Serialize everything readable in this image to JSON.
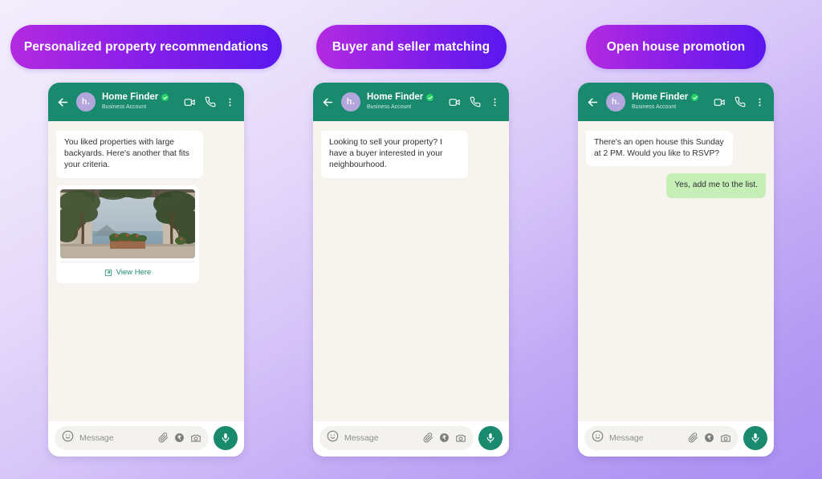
{
  "page": {
    "background_start": "#f2ecfb",
    "background_end": "#a98ef2"
  },
  "theme": {
    "pill_gradient_start": "#b32ae0",
    "pill_gradient_end": "#5a18ef",
    "whatsapp_green": "#1a8a6e",
    "verified_green": "#25d366",
    "outgoing_bubble": "#c5efb6",
    "chat_background": "#f7f4ef",
    "avatar_color": "#b3a6dd"
  },
  "panels": [
    {
      "badge_label": "Personalized property recommendations",
      "header": {
        "back_icon": "back-arrow-icon",
        "avatar_initials": "h.",
        "name": "Home Finder",
        "verified_icon": "verified-check-icon",
        "subtitle": "Business Account",
        "video_icon": "video-call-icon",
        "call_icon": "phone-call-icon",
        "menu_icon": "more-options-icon"
      },
      "messages": [
        {
          "type": "incoming",
          "text": "You liked properties with large backyards. Here's another that fits your criteria."
        },
        {
          "type": "media-card",
          "image_alt": "property-photo-terrace-sea-view",
          "link_icon": "external-link-icon",
          "link_label": "View Here"
        }
      ],
      "input": {
        "emoji_icon": "emoji-icon",
        "placeholder": "Message",
        "attach_icon": "paperclip-icon",
        "payment_icon": "rupee-payment-icon",
        "camera_icon": "camera-icon",
        "mic_icon": "microphone-icon"
      }
    },
    {
      "badge_label": "Buyer and seller matching",
      "header": {
        "back_icon": "back-arrow-icon",
        "avatar_initials": "h.",
        "name": "Home Finder",
        "verified_icon": "verified-check-icon",
        "subtitle": "Business Account",
        "video_icon": "video-call-icon",
        "call_icon": "phone-call-icon",
        "menu_icon": "more-options-icon"
      },
      "messages": [
        {
          "type": "incoming",
          "text": "Looking to sell your property? I have a buyer interested in your neighbourhood."
        }
      ],
      "input": {
        "emoji_icon": "emoji-icon",
        "placeholder": "Message",
        "attach_icon": "paperclip-icon",
        "payment_icon": "rupee-payment-icon",
        "camera_icon": "camera-icon",
        "mic_icon": "microphone-icon"
      }
    },
    {
      "badge_label": "Open house promotion",
      "header": {
        "back_icon": "back-arrow-icon",
        "avatar_initials": "h.",
        "name": "Home Finder",
        "verified_icon": "verified-check-icon",
        "subtitle": "Business Account",
        "video_icon": "video-call-icon",
        "call_icon": "phone-call-icon",
        "menu_icon": "more-options-icon"
      },
      "messages": [
        {
          "type": "incoming",
          "text": "There's an open house this Sunday at 2 PM. Would you like to RSVP?"
        },
        {
          "type": "outgoing",
          "text": "Yes, add me to the list."
        }
      ],
      "input": {
        "emoji_icon": "emoji-icon",
        "placeholder": "Message",
        "attach_icon": "paperclip-icon",
        "payment_icon": "rupee-payment-icon",
        "camera_icon": "camera-icon",
        "mic_icon": "microphone-icon"
      }
    }
  ]
}
